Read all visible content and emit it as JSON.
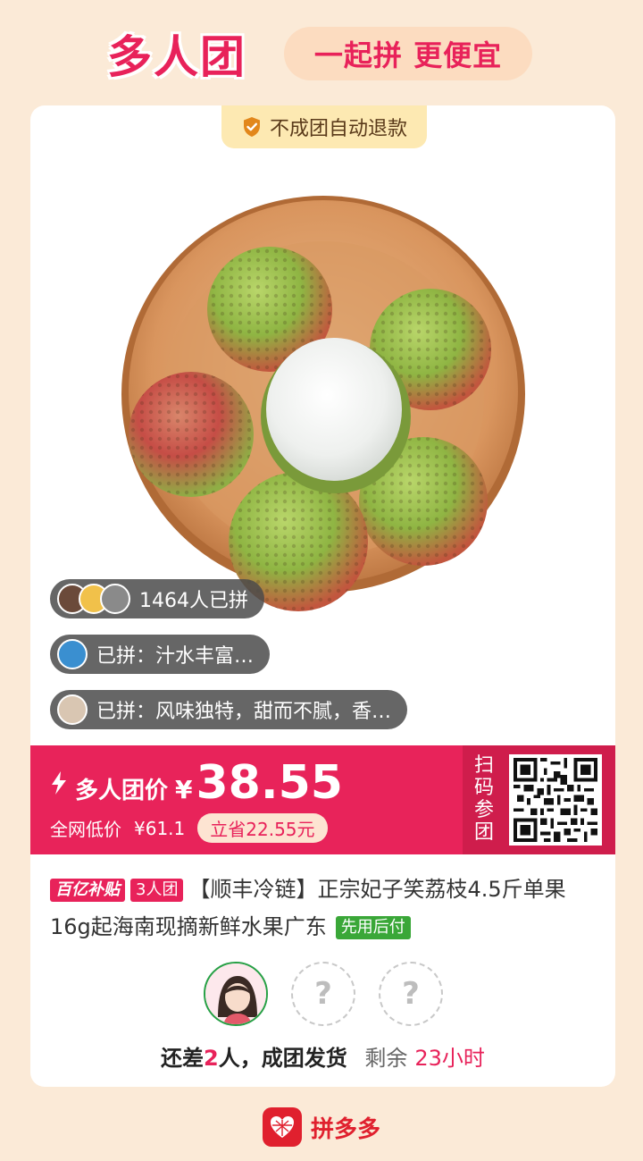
{
  "header": {
    "title": "多人团",
    "slogan": "一起拼 更便宜"
  },
  "card": {
    "refund_tag": "不成团自动退款",
    "buyers": {
      "count_text": "1464人已拼",
      "review_1": "已拼：汁水丰富…",
      "review_2": "已拼：风味独特，甜而不腻，香…"
    },
    "price": {
      "label": "多人团价",
      "currency": "¥",
      "value": "38.55",
      "lowest_label": "全网低价",
      "lowest_value": "¥61.1",
      "save_text": "立省22.55元"
    },
    "scan": {
      "label": "扫码参团"
    },
    "product": {
      "tag_subsidy": "百亿补贴",
      "tag_group": "3人团",
      "title": "【顺丰冷链】正宗妃子笑荔枝4.5斤单果16g起海南现摘新鲜水果广东",
      "tag_paylater": "先用后付"
    },
    "group": {
      "empty_slot_symbol": "?",
      "status_prefix": "还差",
      "status_count": "2",
      "status_suffix": "人，成团发货",
      "remain_label": "剩余",
      "remain_time": "23小时"
    }
  },
  "footer": {
    "brand": "拼多多"
  },
  "colors": {
    "accent": "#e8225a",
    "background": "#fbead7",
    "pay_later": "#3aa738"
  },
  "icons": [
    "shield-check-icon",
    "lightning-icon",
    "qr-code-icon",
    "pinduoduo-logo-icon"
  ]
}
